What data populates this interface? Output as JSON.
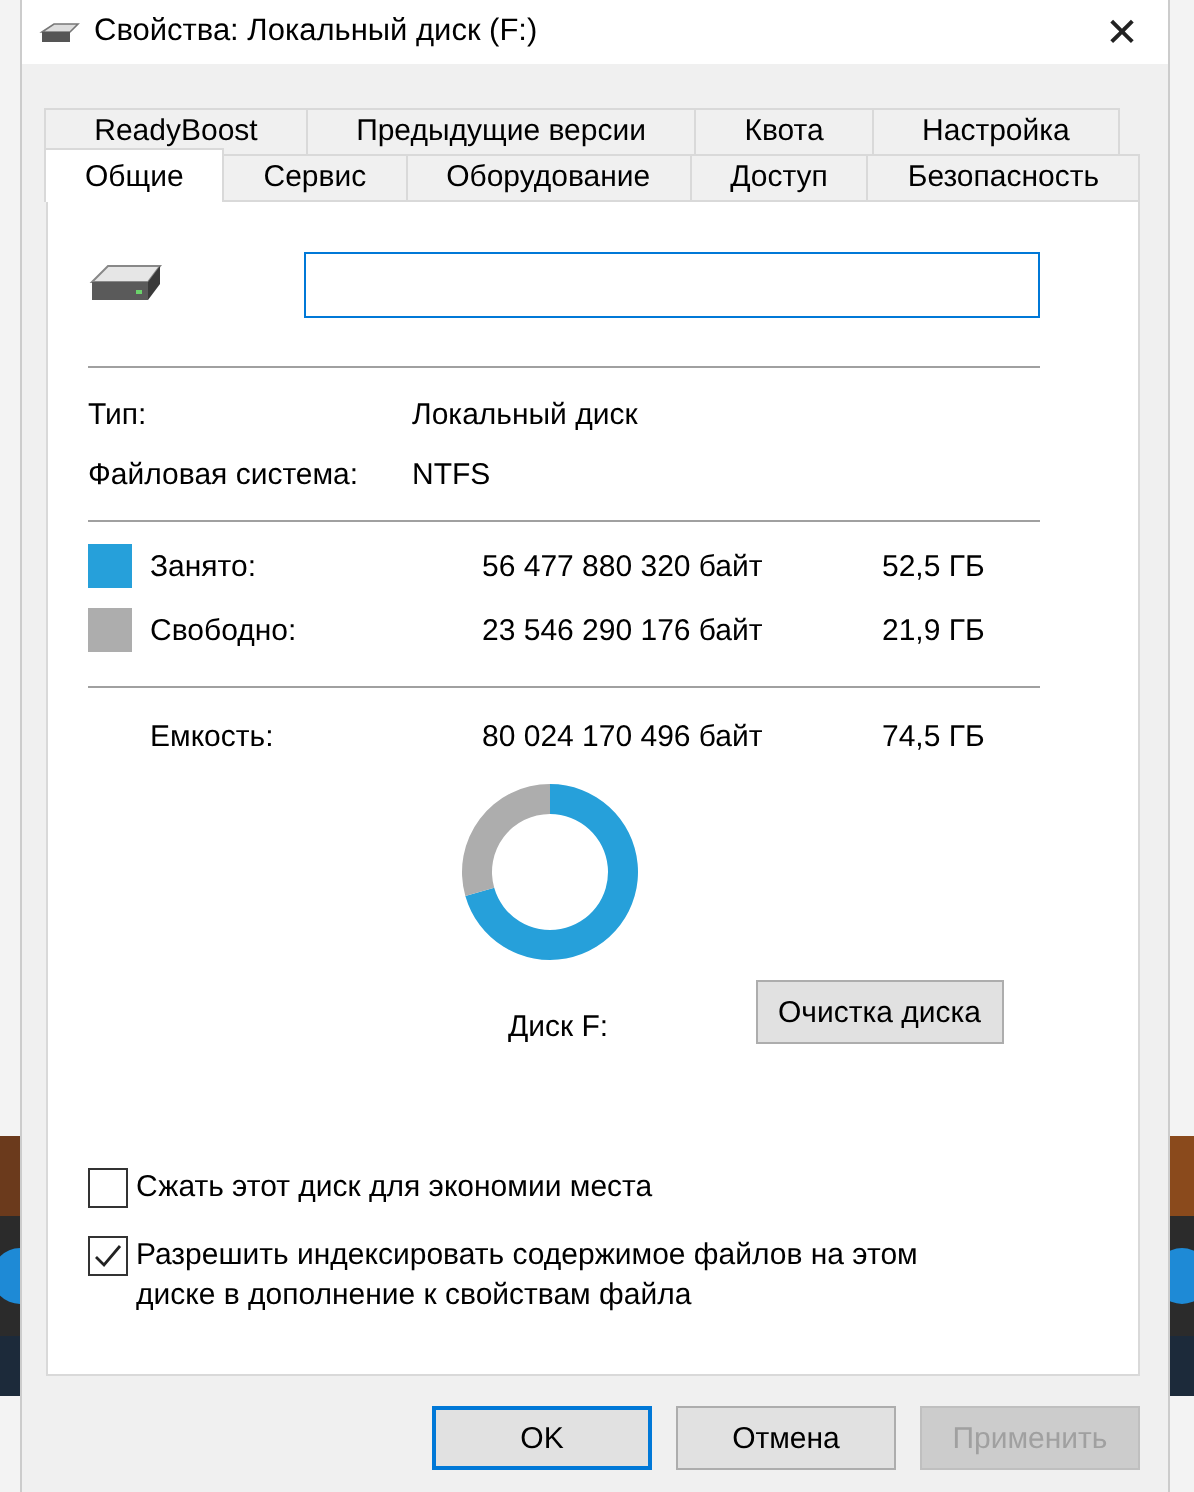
{
  "window": {
    "title": "Свойства: Локальный диск (F:)",
    "close": "✕"
  },
  "tabs_back": [
    {
      "label": "ReadyBoost",
      "selected": false
    },
    {
      "label": "Предыдущие версии",
      "selected": false
    },
    {
      "label": "Квота",
      "selected": false
    },
    {
      "label": "Настройка",
      "selected": false
    }
  ],
  "tabs_front": [
    {
      "label": "Общие",
      "selected": true
    },
    {
      "label": "Сервис",
      "selected": false
    },
    {
      "label": "Оборудование",
      "selected": false
    },
    {
      "label": "Доступ",
      "selected": false
    },
    {
      "label": "Безопасность",
      "selected": false
    }
  ],
  "info": [
    {
      "label": "Тип:",
      "value": "Локальный диск"
    },
    {
      "label": "Файловая система:",
      "value": "NTFS"
    }
  ],
  "space": [
    {
      "label": "Занято:",
      "bytes": "56 477 880 320 байт",
      "size": "52,5 ГБ",
      "color": "#26a0da"
    },
    {
      "label": "Свободно:",
      "bytes": "23 546 290 176 байт",
      "size": "21,9 ГБ",
      "color": "#adadad"
    }
  ],
  "capacity": {
    "label": "Емкость:",
    "bytes": "80 024 170 496 байт",
    "size": "74,5 ГБ"
  },
  "usage": {
    "chart_data": {
      "type": "donut",
      "values": [
        70.6,
        29.4
      ]
    }
  },
  "disk_label": "Диск F:",
  "cleanup_button": "Очистка диска",
  "options": [
    {
      "label": "Сжать этот диск для экономии места",
      "checked": false
    },
    {
      "label": "Разрешить индексировать содержимое файлов на этом диске в дополнение к свойствам файла",
      "checked": true
    }
  ],
  "buttons": [
    {
      "label": "OK",
      "disabled": false,
      "default": true
    },
    {
      "label": "Отмена",
      "disabled": false,
      "default": false
    },
    {
      "label": "Применить",
      "disabled": true,
      "default": false
    }
  ]
}
